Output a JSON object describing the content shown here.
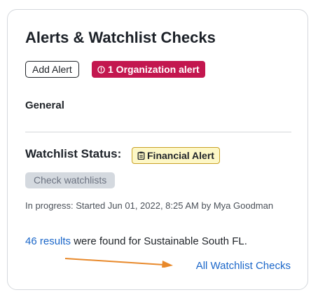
{
  "card": {
    "title": "Alerts & Watchlist Checks",
    "add_alert_label": "Add Alert",
    "org_alert_badge": {
      "icon": "alert-circle-icon",
      "label": "1 Organization alert",
      "color": "#c3174f"
    },
    "general_heading": "General"
  },
  "watchlist": {
    "status_label": "Watchlist Status:",
    "status_badge": {
      "icon": "clipboard-icon",
      "label": "Financial Alert",
      "background": "#fdf7c6"
    },
    "check_button_label": "Check watchlists",
    "progress_text": "In progress: Started Jun 01, 2022, 8:25 AM by Mya Goodman",
    "results_link": "46 results",
    "results_text": " were found for Sustainable South FL.",
    "all_checks_link": "All Watchlist Checks"
  },
  "colors": {
    "link": "#1a66c9",
    "annotation_arrow": "#e8892b"
  }
}
